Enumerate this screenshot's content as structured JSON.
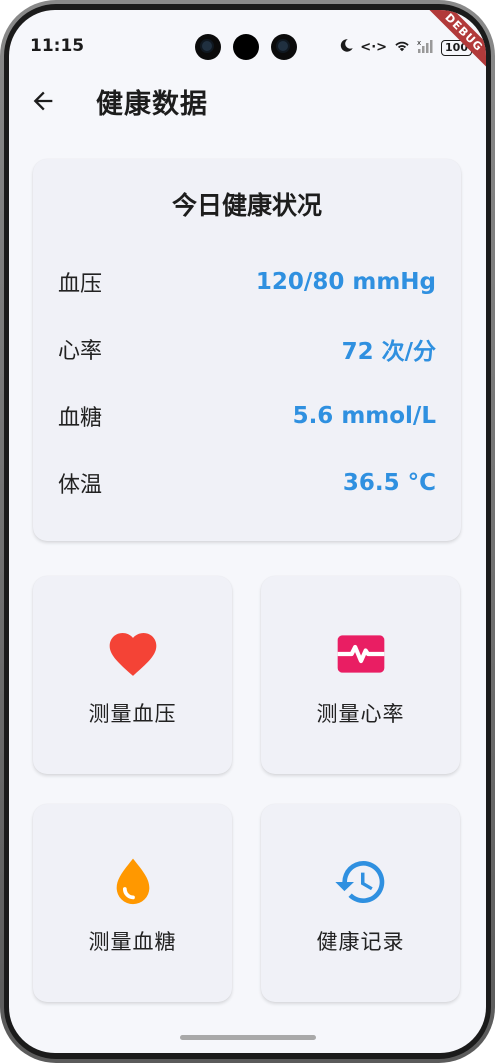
{
  "status_bar": {
    "time": "11:15",
    "battery": "100",
    "debug_banner": "DEBUG",
    "icons": [
      "moon-icon",
      "data-arrows-icon",
      "wifi-icon",
      "signal-icon",
      "battery-icon"
    ]
  },
  "app_bar": {
    "back_icon": "arrow-left-icon",
    "title": "健康数据"
  },
  "summary": {
    "title": "今日健康状况",
    "rows": [
      {
        "label": "血压",
        "value": "120/80 mmHg"
      },
      {
        "label": "心率",
        "value": "72 次/分"
      },
      {
        "label": "血糖",
        "value": "5.6 mmol/L"
      },
      {
        "label": "体温",
        "value": "36.5 °C"
      }
    ],
    "value_color": "#2f90e0"
  },
  "tiles": [
    {
      "label": "测量血压",
      "icon": "heart-icon",
      "color": "#f44336"
    },
    {
      "label": "测量心率",
      "icon": "monitor-heart-icon",
      "color": "#e91e63"
    },
    {
      "label": "测量血糖",
      "icon": "water-drop-icon",
      "color": "#ff9800"
    },
    {
      "label": "健康记录",
      "icon": "history-icon",
      "color": "#2f90e0"
    }
  ]
}
